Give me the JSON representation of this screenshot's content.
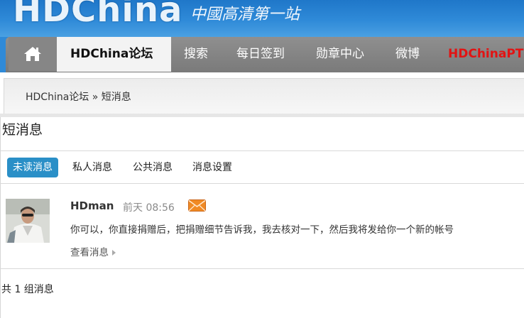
{
  "banner": {
    "logo_text": "HDChina",
    "slogan": "中國高清第一站"
  },
  "nav": {
    "home_icon": "home-icon",
    "items": [
      {
        "label": "HDChina论坛",
        "active": true
      },
      {
        "label": "搜索"
      },
      {
        "label": "每日签到"
      },
      {
        "label": "勋章中心"
      },
      {
        "label": "微博"
      },
      {
        "label": "HDChinaPT",
        "highlight_color": "#e21313"
      }
    ]
  },
  "breadcrumb": {
    "root": "HDChina论坛",
    "separator": "»",
    "current": "短消息"
  },
  "page": {
    "title": "短消息"
  },
  "tabs": [
    {
      "label": "未读消息",
      "active": true
    },
    {
      "label": "私人消息"
    },
    {
      "label": "公共消息"
    },
    {
      "label": "消息设置"
    }
  ],
  "message": {
    "sender": "HDman",
    "time": "前天 08:56",
    "unread_icon": "envelope-icon",
    "text": "你可以，你直接捐赠后，把捐赠细节告诉我，我去核对一下，然后我将发给你一个新的帐号",
    "view_label": "查看消息"
  },
  "footer": {
    "count_text": "共 1 组消息"
  },
  "colors": {
    "accent": "#2a8fc7",
    "banner": "#2f8ad8",
    "nav": "#888888",
    "highlight": "#e21313",
    "envelope": "#f08a24"
  }
}
